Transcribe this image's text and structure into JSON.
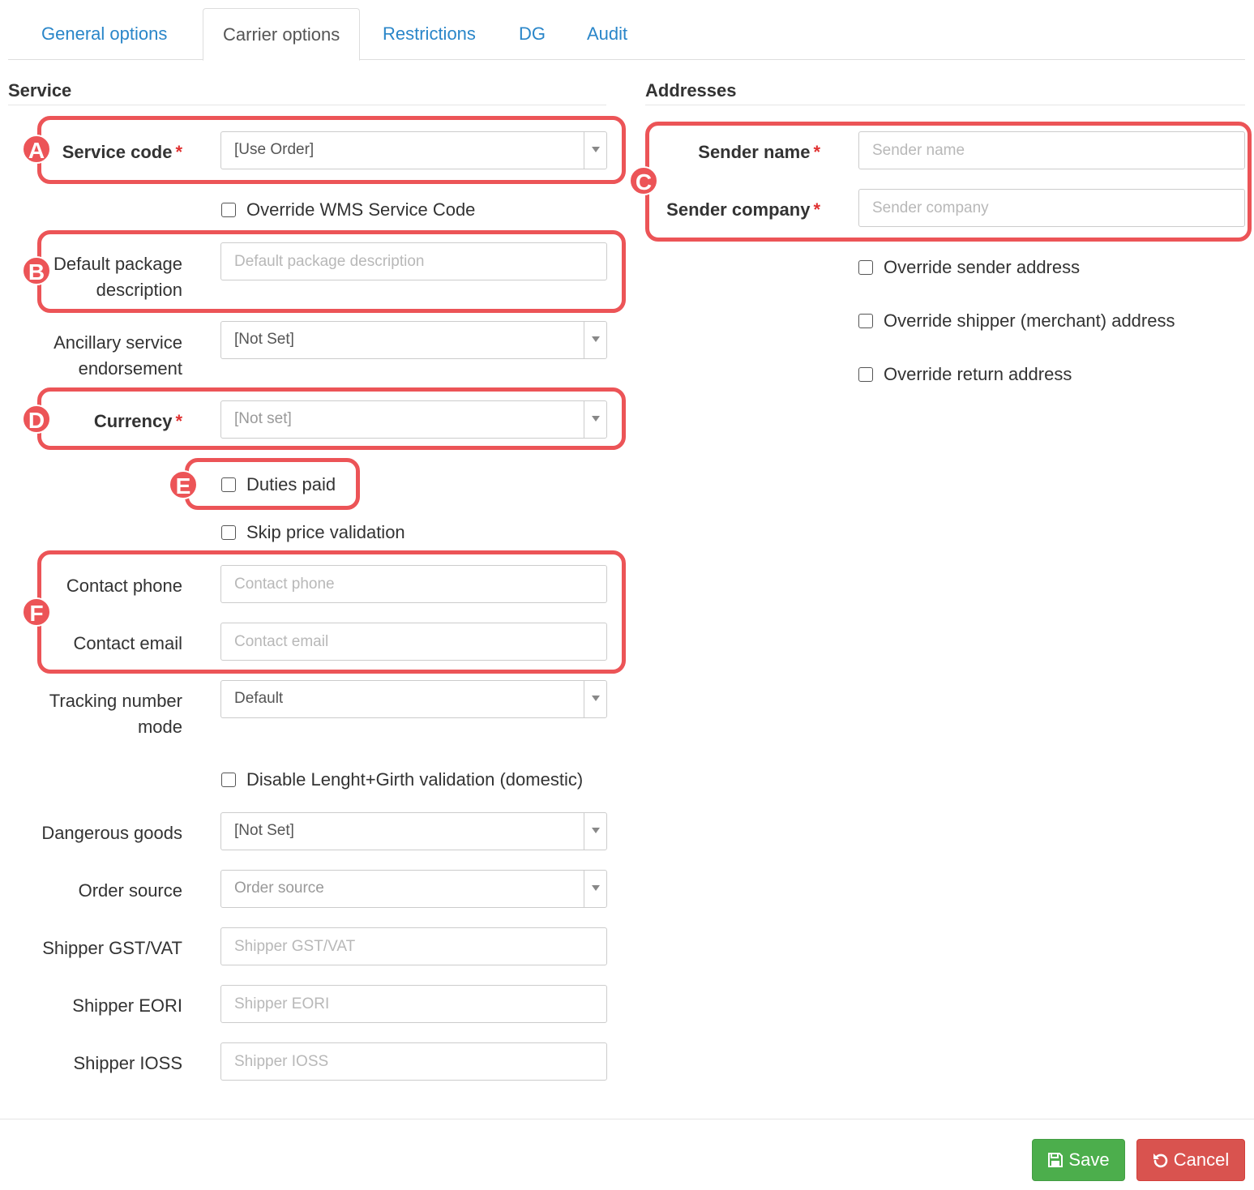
{
  "tabs": [
    {
      "label": "General options",
      "active": false
    },
    {
      "label": "Carrier options",
      "active": true
    },
    {
      "label": "Restrictions",
      "active": false
    },
    {
      "label": "DG",
      "active": false
    },
    {
      "label": "Audit",
      "active": false
    }
  ],
  "service": {
    "title": "Service",
    "service_code": {
      "label": "Service code",
      "value": "[Use Order]"
    },
    "override_wms": "Override WMS Service Code",
    "default_package": {
      "label_line1": "Default package",
      "label_line2": "description",
      "placeholder": "Default package description"
    },
    "ancillary": {
      "label_line1": "Ancillary service",
      "label_line2": "endorsement",
      "value": "[Not Set]"
    },
    "currency": {
      "label": "Currency",
      "value": "[Not set]"
    },
    "duties_paid": "Duties paid",
    "skip_price": "Skip price validation",
    "contact_phone": {
      "label": "Contact phone",
      "placeholder": "Contact phone"
    },
    "contact_email": {
      "label": "Contact email",
      "placeholder": "Contact email"
    },
    "tracking_mode": {
      "label_line1": "Tracking number",
      "label_line2": "mode",
      "value": "Default"
    },
    "disable_lg": "Disable Lenght+Girth validation (domestic)",
    "dangerous_goods": {
      "label": "Dangerous goods",
      "value": "[Not Set]"
    },
    "order_source": {
      "label": "Order source",
      "value": "Order source"
    },
    "shipper_gst": {
      "label": "Shipper GST/VAT",
      "placeholder": "Shipper GST/VAT"
    },
    "shipper_eori": {
      "label": "Shipper EORI",
      "placeholder": "Shipper EORI"
    },
    "shipper_ioss": {
      "label": "Shipper IOSS",
      "placeholder": "Shipper IOSS"
    }
  },
  "addresses": {
    "title": "Addresses",
    "sender_name": {
      "label": "Sender name",
      "placeholder": "Sender name"
    },
    "sender_company": {
      "label": "Sender company",
      "placeholder": "Sender company"
    },
    "override_sender": "Override sender address",
    "override_shipper": "Override shipper (merchant) address",
    "override_return": "Override return address"
  },
  "required_mark": "*",
  "annotations": {
    "a": "A",
    "b": "B",
    "c": "C",
    "d": "D",
    "e": "E",
    "f": "F"
  },
  "buttons": {
    "save": "Save",
    "cancel": "Cancel"
  },
  "colors": {
    "link": "#2a86c9",
    "highlight": "#ec5457",
    "save": "#4cae4c",
    "cancel": "#d9534f",
    "required": "#e03131"
  }
}
